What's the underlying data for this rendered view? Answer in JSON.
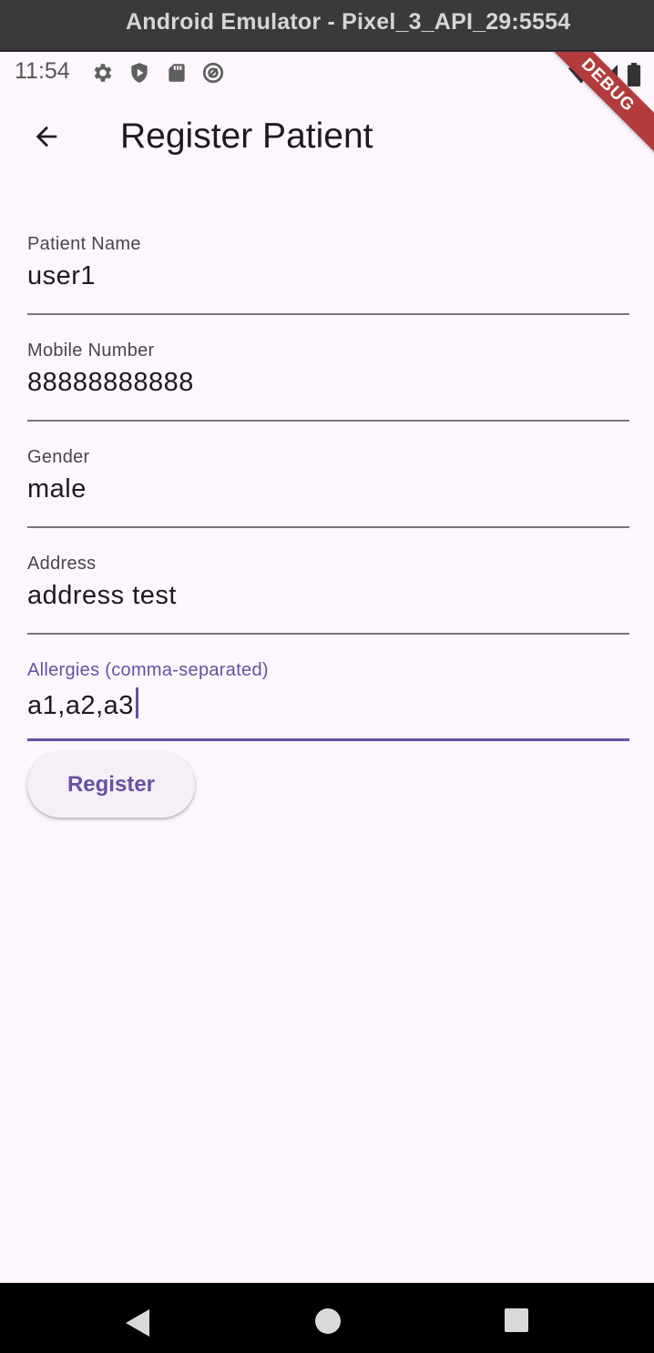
{
  "window": {
    "title": "Android Emulator - Pixel_3_API_29:5554"
  },
  "status_bar": {
    "time": "11:54",
    "left_icons": [
      "gear-icon",
      "shield-icon",
      "sd-card-icon",
      "at-sign-icon"
    ],
    "right_icons": [
      "wifi-icon",
      "signal-icon",
      "battery-icon"
    ]
  },
  "debug_banner": "DEBUG",
  "app_bar": {
    "back_icon": "arrow-back-icon",
    "title": "Register Patient"
  },
  "form": {
    "fields": [
      {
        "label": "Patient Name",
        "value": "user1"
      },
      {
        "label": "Mobile Number",
        "value": "88888888888"
      },
      {
        "label": "Gender",
        "value": "male"
      },
      {
        "label": "Address",
        "value": "address test"
      },
      {
        "label": "Allergies (comma-separated)",
        "value": "a1,a2,a3",
        "focused": true
      }
    ],
    "submit_label": "Register"
  },
  "nav_bar": {
    "buttons": [
      "back-triangle-icon",
      "home-circle-icon",
      "recents-square-icon"
    ]
  },
  "colors": {
    "accent": "#6750a4",
    "background": "#fdf7fd",
    "debug": "#b23b3b"
  }
}
